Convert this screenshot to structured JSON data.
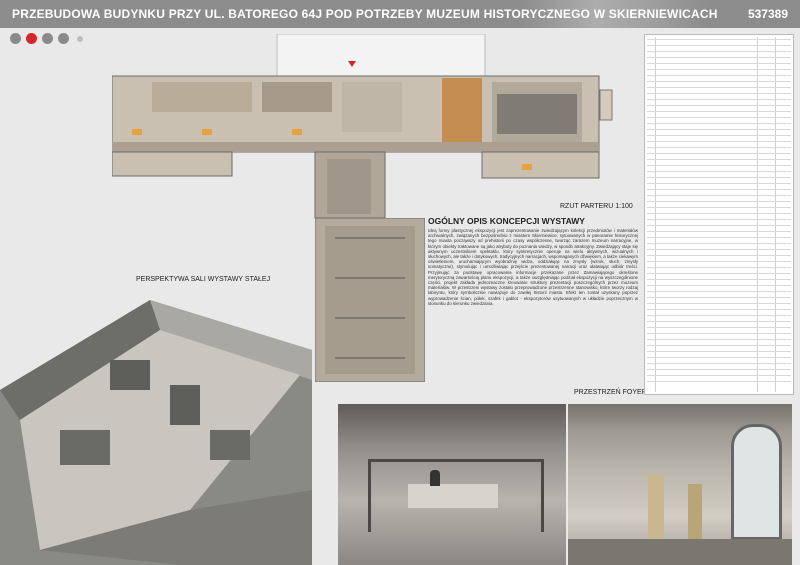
{
  "header": {
    "title": "PRZEBUDOWA BUDYNKU PRZY UL. BATOREGO 64J POD POTRZEBY MUZEUM HISTORYCZNEGO W SKIERNIEWICACH",
    "code": "537389"
  },
  "labels": {
    "plan_caption": "RZUT PARTERU 1:100",
    "perspective_caption": "PERSPEKTYWA SALI WYSTAWY STAŁEJ",
    "foyer_caption": "PRZESTRZEŃ FOYER"
  },
  "description": {
    "heading": "OGÓLNY OPIS KONCEPCJI WYSTAWY",
    "body": "Ideą formy plastycznej ekspozycji jest zaprezentowanie zwiedzającym kolekcji przedmiotów i materiałów archiwalnych, związanych bezpośrednio z miastem Skierniewice, sytuowanych w panoramie historycznej tego miasta począwszy od prehistorii po czasy współczesne, tworząc zarazem muzeum narracyjne, w którym obiekty traktowane są jako atrybuty do poznania wiedzy, w sposób atrakcyjny. Zwiedzający staje się aktywnym uczestnikiem spektaklu, który synkretycznie operuje na wielu aktywnych, wizualnych i słuchowych, ale także i dotykowych, tradycyjnych narracjach, wspomaganych dźwiękiem, a także ciekawym oświetleniem, uruchamiającym wyobraźnię widza, oddziałując na zmysły (wzrok, słuch, zmysły somatyczne), stymulując i umożliwiając przejście prezentowanej narracji oraz ułatwiając odbiór treści. Przyjmując za podstawę opracowania informacje przekazane przez Zamawiającego określone merytoryczną zawartością planu ekspozycji, a także uwzględniając podział ekspozycji na wyszczególnione części, projekt zakłada jednoznaczne kreowanie struktury prezentacji poszczególnych przez muzeum materiałów. W przestrzeni wystawy zostało przeprowadzone przestrzenne stanowisko, które tworzy rodzaj labiryntu, który symbolicznie nawiązuje do zawiłej historii miasta. Efekt ten został uzyskany poprzez wyprowadzenie ścian, półek, szafek i gablot - ekspozytorów usytuowanych w układzie poprzecznym w stosunku do kierunku zwiedzania."
  },
  "colors": {
    "header_bg": "#8c8c8c",
    "accent_red": "#d12828",
    "page_bg": "#e9e9e9"
  }
}
